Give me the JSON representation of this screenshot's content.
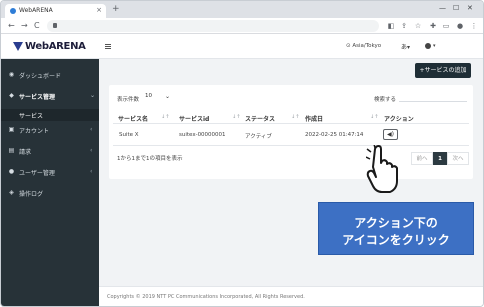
{
  "browser": {
    "tab_title": "WebARENA",
    "tab_close": "×",
    "new_tab": "+",
    "win_minimize": "—",
    "win_maximize": "☐",
    "win_close": "✕",
    "back": "←",
    "forward": "→",
    "reload": "C"
  },
  "header": {
    "logo": "WebARENA",
    "timezone": "⊙ Asia/Tokyo",
    "language": "あ▾",
    "user_caret": "▾"
  },
  "sidebar": {
    "items": [
      {
        "label": "ダッシュボード",
        "icon": "dashboard-icon",
        "glyph": "◉",
        "chevron": ""
      },
      {
        "label": "サービス管理",
        "icon": "services-icon",
        "glyph": "◆",
        "chevron": "⌄",
        "active": true
      },
      {
        "label": "アカウント",
        "icon": "account-icon",
        "glyph": "▣",
        "chevron": "‹"
      },
      {
        "label": "請求",
        "icon": "billing-icon",
        "glyph": "▤",
        "chevron": "‹"
      },
      {
        "label": "ユーザー管理",
        "icon": "users-icon",
        "glyph": "●",
        "chevron": "‹"
      },
      {
        "label": "操作ログ",
        "icon": "log-icon",
        "glyph": "◈",
        "chevron": ""
      }
    ],
    "sub_item": "サービス"
  },
  "main": {
    "add_button": "+サービスの追加",
    "page_size_label": "表示件数",
    "page_size_value": "10",
    "page_size_caret": "⌄",
    "search_label": "検索する",
    "columns": [
      "サービス名",
      "サービスid",
      "ステータス",
      "作成日",
      "アクション"
    ],
    "sort_glyph": "↓↑",
    "rows": [
      {
        "name": "Suite X",
        "id": "suitex-00000001",
        "status": "アクティブ",
        "created": "2022-02-25 01:47:14",
        "action_icon": "◀)"
      }
    ],
    "info": "1から1まで1の項目を表示",
    "pager": {
      "prev": "前へ",
      "current": "1",
      "next": "次へ"
    }
  },
  "footer": "Copyrights © 2019 NTT PC Communications Incorporated, All Rights Reserved.",
  "callout": {
    "line1": "アクション下の",
    "line2": "アイコンをクリック"
  },
  "colors": {
    "sidebar": "#273238",
    "accent": "#3d70c4",
    "button_dark": "#1f2e36"
  }
}
